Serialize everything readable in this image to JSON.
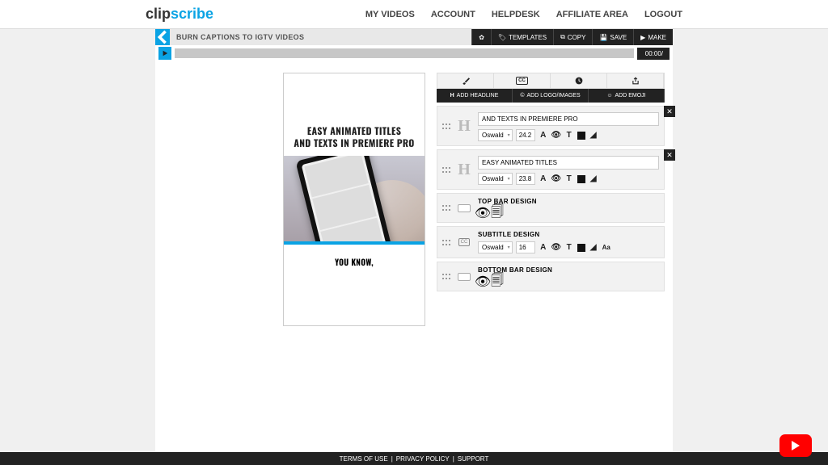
{
  "logo": {
    "part1": "clip",
    "part2": "scribe"
  },
  "nav": [
    {
      "label": "MY VIDEOS"
    },
    {
      "label": "ACCOUNT"
    },
    {
      "label": "HELPDESK"
    },
    {
      "label": "AFFILIATE AREA"
    },
    {
      "label": "LOGOUT"
    }
  ],
  "titlebar": {
    "title": "BURN CAPTIONS TO IGTV VIDEOS"
  },
  "title_actions": {
    "templates": "TEMPLATES",
    "copy": "COPY",
    "save": "SAVE",
    "make": "MAKE"
  },
  "playbar": {
    "time": "00:00/"
  },
  "preview": {
    "headline_line1": "EASY ANIMATED TITLES",
    "headline_line2": "AND TEXTS IN PREMIERE PRO",
    "subtitle": "YOU KNOW,"
  },
  "addbar": {
    "headline": "ADD HEADLINE",
    "images": "ADD LOGO/IMAGES",
    "emoji": "ADD EMOJI"
  },
  "panels": {
    "h1": {
      "value": "AND TEXTS IN PREMIERE PRO",
      "font": "Oswald",
      "size": "24.2"
    },
    "h2": {
      "value": "EASY ANIMATED TITLES",
      "font": "Oswald",
      "size": "23.8"
    },
    "top": {
      "label": "TOP BAR DESIGN"
    },
    "sub": {
      "label": "SUBTITLE DESIGN",
      "font": "Oswald",
      "size": "16"
    },
    "bottom": {
      "label": "BOTTOM BAR DESIGN"
    }
  },
  "footer": {
    "terms": "TERMS OF USE",
    "privacy": "PRIVACY POLICY",
    "support": "SUPPORT"
  }
}
